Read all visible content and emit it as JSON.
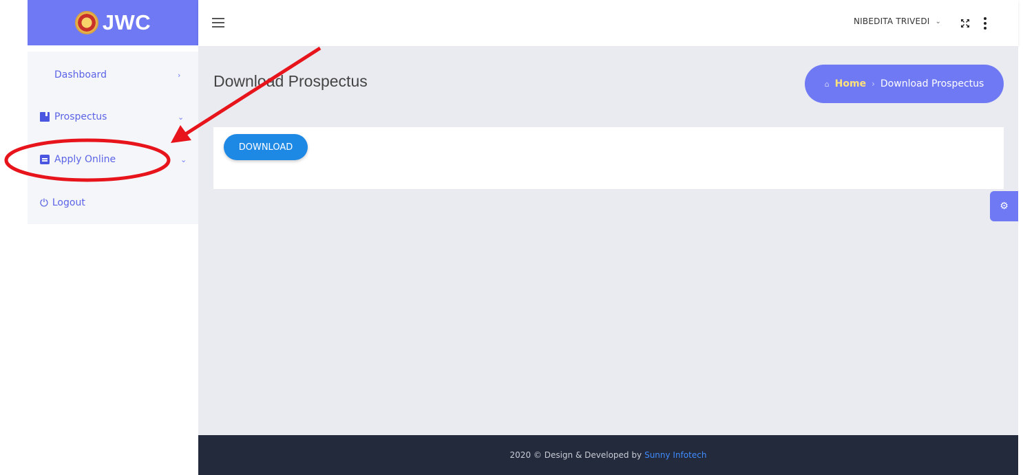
{
  "brand": {
    "name": "JWC"
  },
  "topbar": {
    "user_name": "NIBEDITA TRIVEDI"
  },
  "sidebar": {
    "items": [
      {
        "label": "Dashboard",
        "icon": "dashboard-icon",
        "arrow": "chevron-right-icon"
      },
      {
        "label": "Prospectus",
        "icon": "book-icon",
        "arrow": "chevron-down-icon"
      },
      {
        "label": "Apply Online",
        "icon": "clipboard-icon",
        "arrow": "chevron-down-icon"
      },
      {
        "label": "Logout",
        "icon": "power-icon"
      }
    ]
  },
  "page": {
    "title": "Download Prospectus"
  },
  "breadcrumb": {
    "home": "Home",
    "current": "Download Prospectus"
  },
  "card": {
    "download_label": "DOWNLOAD"
  },
  "footer": {
    "text": "2020 © Design & Developed by",
    "company": "Sunny Infotech"
  },
  "colors": {
    "accent": "#6f79f4",
    "button": "#1e88e5",
    "annotation": "#e8141b",
    "footer_bg": "#232a3b"
  }
}
